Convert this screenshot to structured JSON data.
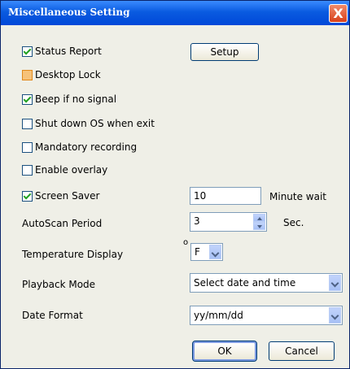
{
  "window": {
    "title": "Miscellaneous Setting",
    "close_glyph": "X"
  },
  "checkboxes": [
    {
      "label": "Status Report",
      "checked": true
    },
    {
      "label": "Desktop Lock",
      "checked": false
    },
    {
      "label": "Beep if no signal",
      "checked": true
    },
    {
      "label": "Shut down OS when exit",
      "checked": false
    },
    {
      "label": "Mandatory recording",
      "checked": false
    },
    {
      "label": "Enable overlay",
      "checked": false
    },
    {
      "label": "Screen Saver",
      "checked": true
    }
  ],
  "setup_button": {
    "label": "Setup"
  },
  "screen_saver": {
    "value": "10",
    "unit": "Minute wait"
  },
  "autoscan": {
    "label": "AutoScan Period",
    "value": "3",
    "unit": "Sec."
  },
  "temperature": {
    "label": "Temperature Display",
    "degree": "o",
    "value": "F"
  },
  "playback": {
    "label": "Playback Mode",
    "value": "Select date and time"
  },
  "date_format": {
    "label": "Date Format",
    "value": "yy/mm/dd"
  },
  "footer": {
    "ok": "OK",
    "cancel": "Cancel"
  },
  "colors": {
    "title_bar": "#0a5be0",
    "close_button": "#d8401a",
    "dialog_bg": "#efefe7"
  }
}
